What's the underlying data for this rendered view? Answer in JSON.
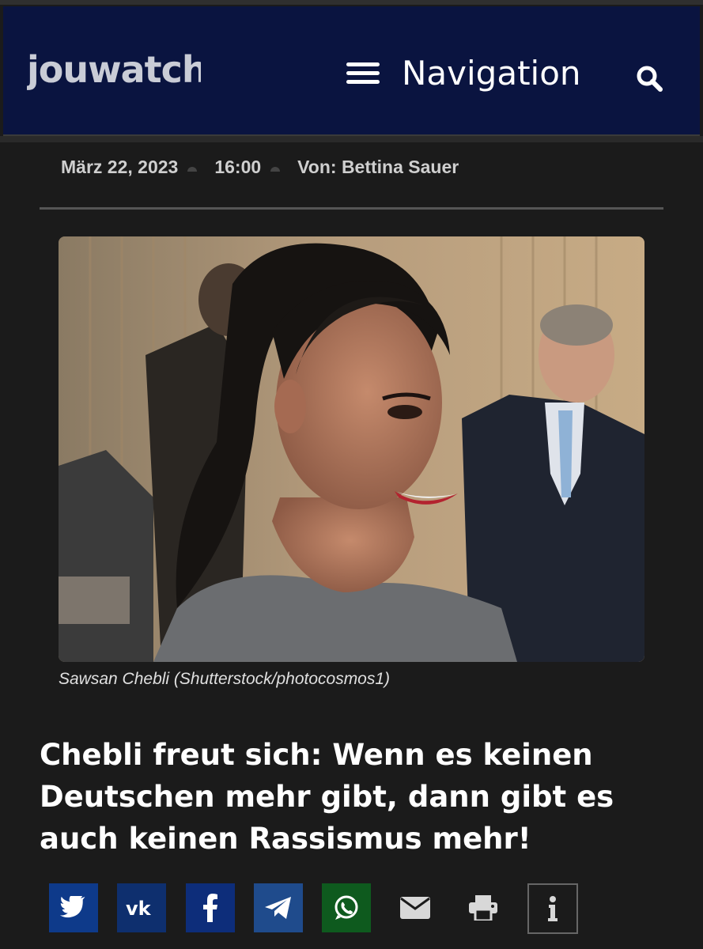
{
  "header": {
    "logo_text": "jouwatch",
    "nav_label": "Navigation"
  },
  "meta": {
    "date": "März 22, 2023",
    "time": "16:00",
    "author": "Von: Bettina Sauer"
  },
  "article": {
    "image_caption": "Sawsan Chebli (Shutterstock/photocosmos1)",
    "headline": "Chebli freut sich: Wenn es keinen Deutschen mehr gibt, dann gibt es auch keinen Rassismus mehr!"
  },
  "share_buttons": [
    {
      "icon": "twitter-icon",
      "color": "#0e3a8a"
    },
    {
      "icon": "vk-icon",
      "color": "#0e2f6e"
    },
    {
      "icon": "facebook-icon",
      "color": "#0d2d7a"
    },
    {
      "icon": "telegram-icon",
      "color": "#1f4b8c"
    },
    {
      "icon": "whatsapp-icon",
      "color": "#0e5a1e"
    },
    {
      "icon": "email-icon",
      "color": "#1b1b1b"
    },
    {
      "icon": "print-icon",
      "color": "#1b1b1b"
    },
    {
      "icon": "info-icon",
      "color": "#1b1b1b"
    }
  ],
  "colors": {
    "header_bg": "#0a1440",
    "page_bg": "#1b1b1b"
  }
}
